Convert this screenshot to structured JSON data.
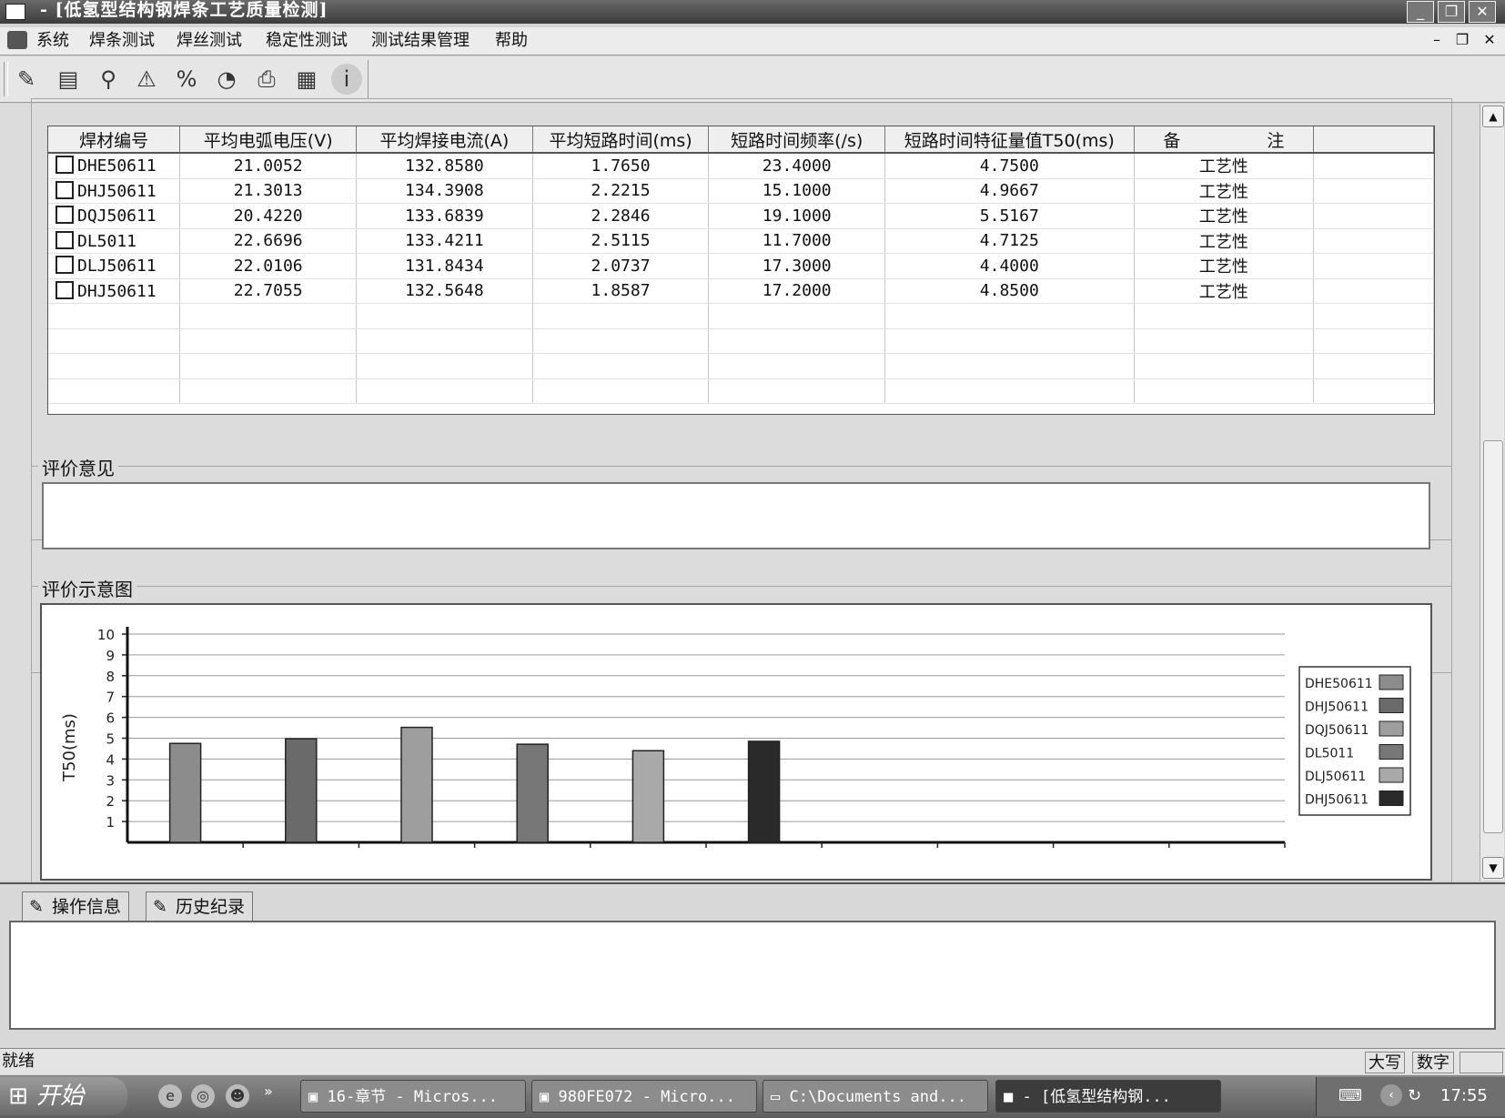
{
  "window": {
    "title": "- [低氢型结构钢焊条工艺质量检测]",
    "controls": [
      "_",
      "❐",
      "✕"
    ]
  },
  "menu": {
    "items": [
      "系统",
      "焊条测试",
      "焊丝测试",
      "稳定性测试",
      "测试结果管理",
      "帮助"
    ],
    "mdi_controls": [
      "–",
      "❐",
      "✕"
    ]
  },
  "toolbar": {
    "icons": [
      "edit-icon",
      "clipboard-icon",
      "search-icon",
      "measure-icon",
      "percent-icon",
      "chart-icon",
      "print-icon",
      "export-icon",
      "info-icon"
    ]
  },
  "table": {
    "headers": [
      "焊材编号",
      "平均电弧电压(V)",
      "平均焊接电流(A)",
      "平均短路时间(ms)",
      "短路时间频率(/s)",
      "短路时间特征量值T50(ms)",
      "备　　　　　注",
      ""
    ],
    "rows": [
      [
        "DHE50611",
        "21.0052",
        "132.8580",
        "1.7650",
        "23.4000",
        "4.7500",
        "工艺性"
      ],
      [
        "DHJ50611",
        "21.3013",
        "134.3908",
        "2.2215",
        "15.1000",
        "4.9667",
        "工艺性"
      ],
      [
        "DQJ50611",
        "20.4220",
        "133.6839",
        "2.2846",
        "19.1000",
        "5.5167",
        "工艺性"
      ],
      [
        "DL5011",
        "22.6696",
        "133.4211",
        "2.5115",
        "11.7000",
        "4.7125",
        "工艺性"
      ],
      [
        "DLJ50611",
        "22.0106",
        "131.8434",
        "2.0737",
        "17.3000",
        "4.4000",
        "工艺性"
      ],
      [
        "DHJ50611",
        "22.7055",
        "132.5648",
        "1.8587",
        "17.2000",
        "4.8500",
        "工艺性"
      ]
    ]
  },
  "evaluation": {
    "label": "评价意见",
    "text": ""
  },
  "chart_section": {
    "label": "评价示意图"
  },
  "chart_data": {
    "type": "bar",
    "ylabel": "T50(ms)",
    "ylim": [
      0,
      10
    ],
    "yticks": [
      "1",
      "2",
      "3",
      "4",
      "5",
      "6",
      "7",
      "8",
      "9",
      "10"
    ],
    "grid": true,
    "legend": "right",
    "series": [
      {
        "name": "DHE50611",
        "value": 4.75,
        "color": "#8c8c8c"
      },
      {
        "name": "DHJ50611",
        "value": 4.97,
        "color": "#6a6a6a"
      },
      {
        "name": "DQJ50611",
        "value": 5.52,
        "color": "#9e9e9e"
      },
      {
        "name": "DL5011",
        "value": 4.71,
        "color": "#777777"
      },
      {
        "name": "DLJ50611",
        "value": 4.4,
        "color": "#a9a9a9"
      },
      {
        "name": "DHJ50611",
        "value": 4.85,
        "color": "#2a2a2a"
      }
    ],
    "slots": 10
  },
  "bottom_tabs": [
    "操作信息",
    "历史纪录"
  ],
  "status": {
    "text": "就绪",
    "caps": "大写",
    "num": "数字"
  },
  "taskbar": {
    "start": "开始",
    "tasks": [
      "16-章节 - Micros...",
      "980FE072 - Micro...",
      "C:\\Documents and...",
      "- [低氢型结构钢..."
    ],
    "time": "17:55"
  }
}
